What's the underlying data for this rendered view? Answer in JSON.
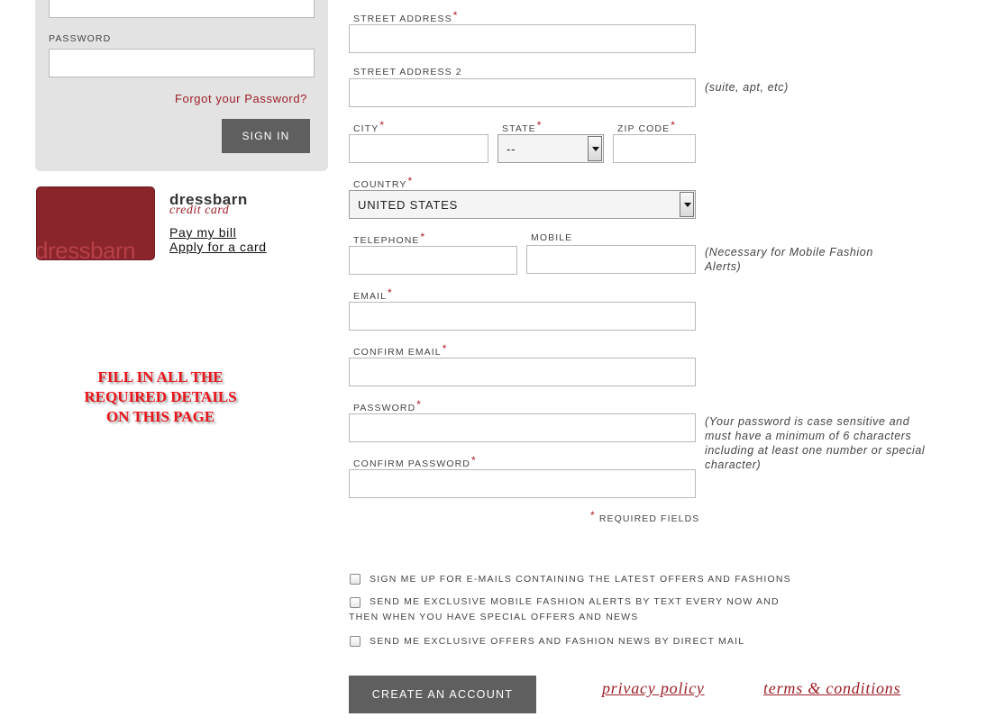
{
  "signin": {
    "password_label": "PASSWORD",
    "forgot_link": "Forgot your Password?",
    "signin_button": "SIGN IN"
  },
  "credit_card": {
    "card_logo": "dressbarn",
    "brand": "dressbarn",
    "subtitle": "credit card",
    "pay_link": "Pay my bill",
    "apply_link": "Apply for a card"
  },
  "instruction": {
    "lines": [
      "FILL IN ALL THE",
      "REQUIRED DETAILS",
      "ON THIS PAGE"
    ]
  },
  "form": {
    "street_address_label": "STREET ADDRESS",
    "street_address2_label": "STREET ADDRESS 2",
    "street_address2_hint": "(suite, apt, etc)",
    "city_label": "CITY",
    "state_label": "STATE",
    "state_value": "--",
    "zip_label": "ZIP CODE",
    "country_label": "COUNTRY",
    "country_value": "UNITED STATES",
    "telephone_label": "TELEPHONE",
    "mobile_label": "MOBILE",
    "mobile_hint_line1": "(Necessary for Mobile Fashion",
    "mobile_hint_line2": "Alerts)",
    "email_label": "EMAIL",
    "confirm_email_label": "CONFIRM EMAIL",
    "password_label": "PASSWORD",
    "password_hint_line1": "(Your password is case sensitive and",
    "password_hint_line2": "must have a minimum of 6 characters",
    "password_hint_line3": "including at least one number or special",
    "password_hint_line4": "character)",
    "confirm_password_label": "CONFIRM PASSWORD",
    "required_star": "*",
    "required_note": "REQUIRED FIELDS"
  },
  "options": {
    "emails_offers": "SIGN ME UP FOR E-MAILS CONTAINING THE LATEST OFFERS AND FASHIONS",
    "mobile_alerts_line1": "SEND ME EXCLUSIVE MOBILE FASHION ALERTS BY TEXT EVERY NOW AND",
    "mobile_alerts_line2": "THEN WHEN YOU HAVE SPECIAL OFFERS AND NEWS",
    "direct_mail": "SEND ME EXCLUSIVE OFFERS AND FASHION NEWS BY DIRECT MAIL"
  },
  "footer": {
    "create_button": "CREATE AN ACCOUNT",
    "privacy_link": "privacy policy",
    "terms_link": "terms & conditions"
  },
  "colors": {
    "accent": "#9c1f27",
    "button": "#5f5f5f",
    "instruction": "#e8141b"
  }
}
